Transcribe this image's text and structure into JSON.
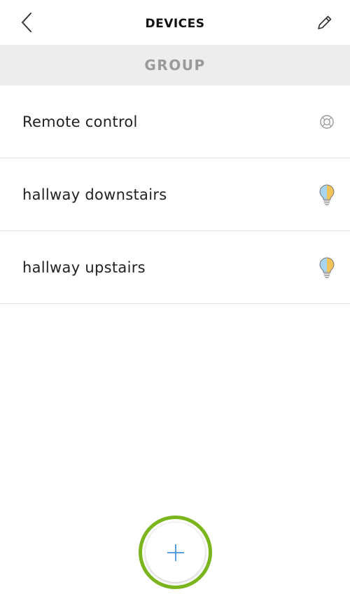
{
  "header": {
    "title": "DEVICES",
    "back_icon": "chevron-left-icon",
    "edit_icon": "pencil-icon"
  },
  "section": {
    "label": "GROUP"
  },
  "devices": [
    {
      "name": "Remote control",
      "icon": "remote-control-icon"
    },
    {
      "name": "hallway downstairs",
      "icon": "light-bulb-icon"
    },
    {
      "name": "hallway upstairs",
      "icon": "light-bulb-icon"
    }
  ],
  "fab": {
    "icon": "plus-icon"
  },
  "colors": {
    "accent_green": "#7ab51d",
    "plus_blue": "#5aa0dc",
    "section_bg": "#ededed",
    "section_text": "#9a9a9a",
    "bulb_blue": "#a9d4ee",
    "bulb_yellow": "#f2c35a"
  }
}
